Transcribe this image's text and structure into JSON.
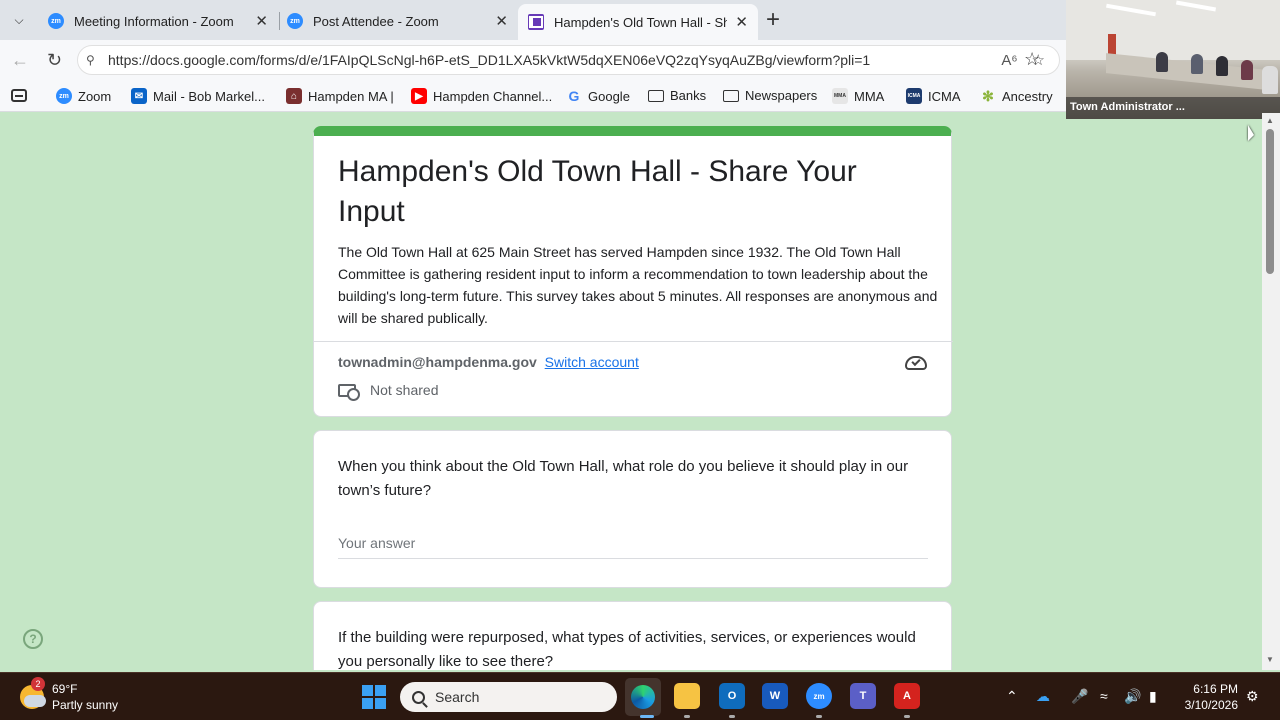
{
  "browser": {
    "tabs": [
      {
        "title": "Meeting Information - Zoom",
        "icon": "zoom-icon"
      },
      {
        "title": "Post Attendee - Zoom",
        "icon": "zoom-icon"
      },
      {
        "title": "Hampden's Old Town Hall - Share",
        "icon": "google-forms-icon",
        "active": true
      }
    ],
    "url": "https://docs.google.com/forms/d/e/1FAIpQLScNgl-h6P-etS_DD1LXA5kVktW5dqXEN06eVQ2zqYsyqAuZBg/viewform?pli=1",
    "favicon_label": "zm",
    "bookmarks": [
      {
        "label": "Zoom",
        "icon": "zoom-icon"
      },
      {
        "label": "Mail - Bob Markel...",
        "icon": "mail-icon"
      },
      {
        "label": "Hampden MA |",
        "icon": "town-icon"
      },
      {
        "label": "Hampden Channel...",
        "icon": "youtube-icon"
      },
      {
        "label": "Google",
        "icon": "google-icon"
      },
      {
        "label": "Banks",
        "icon": "folder-icon"
      },
      {
        "label": "Newspapers",
        "icon": "folder-icon"
      },
      {
        "label": "MMA",
        "icon": "mma-icon"
      },
      {
        "label": "ICMA",
        "icon": "icma-icon"
      },
      {
        "label": "Ancestry",
        "icon": "ancestry-icon"
      }
    ]
  },
  "video": {
    "caption": "Town Administrator ..."
  },
  "form": {
    "title": "Hampden's Old Town Hall - Share Your Input",
    "description": "The Old Town Hall at 625 Main Street has served Hampden since 1932. The Old Town Hall Committee is gathering resident input to inform a recommendation to town leadership about the building's long-term future. This survey takes about 5 minutes. All responses are anonymous and will be shared publically.",
    "account_email": "townadmin@hampdenma.gov",
    "switch_account": "Switch account",
    "not_shared": "Not shared",
    "accent_color": "#4caf50",
    "questions": [
      {
        "text": "When you think about the Old Town Hall, what role do you believe it should play in our town’s future?",
        "placeholder": "Your answer"
      },
      {
        "text": "If the building were repurposed, what types of activities, services, or experiences would you personally like to see there?"
      }
    ]
  },
  "taskbar": {
    "weather_temp": "69°F",
    "weather_desc": "Partly sunny",
    "weather_badge": "2",
    "search_label": "Search",
    "time": "6:16 PM",
    "date": "3/10/2026"
  }
}
